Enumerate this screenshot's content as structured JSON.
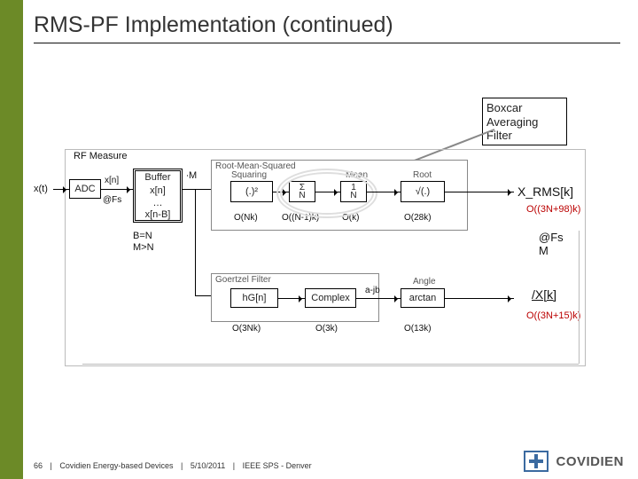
{
  "title": "RMS-PF Implementation (continued)",
  "callout": "Boxcar Averaging Filter",
  "diagram": {
    "rf_caption": "RF Measure",
    "adc": "ADC",
    "buffer": "Buffer",
    "buf_rows": [
      "x[n]",
      "…",
      "x[n-B]"
    ],
    "rms_header": "Root-Mean-Squared",
    "square_label": "Squaring",
    "square": "(.)²",
    "square_cost": "O(Nk)",
    "sum": "Σ\nN",
    "sum_cost": "O((N-1)k)",
    "mean": "1\nN",
    "mean_label": "Mean",
    "mean_cost": "O(k)",
    "root": "√(.)",
    "root_label": "Root",
    "root_cost": "O(28k)",
    "goertzel": "Goertzel Filter",
    "gcoef": "hG[n]",
    "gcoef_cost": "O(3Nk)",
    "complex": "Complex",
    "complex_cost": "O(3k)",
    "arctan": "arctan",
    "arctan_cost": "O(13k)",
    "xt": "x(t)",
    "xn": "x[n]",
    "fs": "@Fs",
    "bM": "∙M",
    "BN": "B=N\nM>N",
    "ab": "a-jb",
    "angle_label": "Angle",
    "Xrms": "X_RMS[k]",
    "Xrms_cost": "O((3N+98)k)",
    "fsM": "@Fs\nM",
    "phase": "/X[k]",
    "phase_cost": "O((3N+15)k)"
  },
  "footer": {
    "page": "66",
    "org": "Covidien Energy-based Devices",
    "date": "5/10/2011",
    "venue": "IEEE SPS - Denver"
  },
  "logo": "COVIDIEN"
}
